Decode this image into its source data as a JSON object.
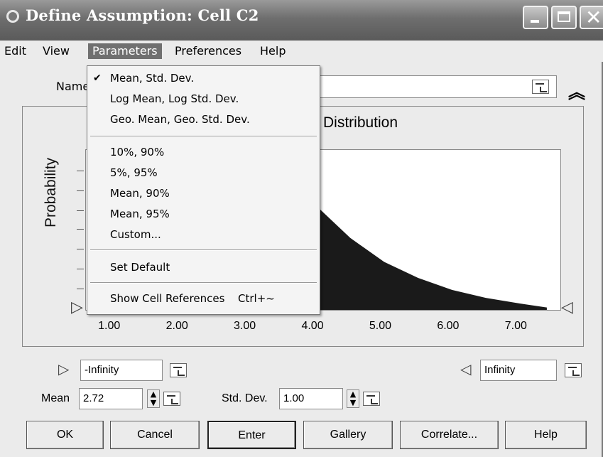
{
  "window": {
    "title": "Define Assumption: Cell C2",
    "controls": {
      "minimize": "minimize-icon",
      "maximize": "maximize-icon",
      "close": "close-icon"
    }
  },
  "menubar": [
    "Edit",
    "View",
    "Parameters",
    "Preferences",
    "Help"
  ],
  "parameters_menu": {
    "groups": [
      [
        "Mean, Std. Dev.",
        "Log Mean, Log Std. Dev.",
        "Geo. Mean, Geo. Std. Dev."
      ],
      [
        "10%, 90%",
        "5%, 95%",
        "Mean, 90%",
        "Mean, 95%",
        "Custom..."
      ],
      [
        "Set Default"
      ],
      [
        "Show Cell References"
      ]
    ],
    "checked": "Mean, Std. Dev.",
    "shortcut": "Ctrl+~"
  },
  "name_label": "Name",
  "chart": {
    "title": "Distribution",
    "ylabel": "Probability"
  },
  "chart_data": {
    "type": "area",
    "title": "Distribution",
    "xlabel": "",
    "ylabel": "Probability",
    "x_ticks": [
      "1.00",
      "2.00",
      "3.00",
      "4.00",
      "5.00",
      "6.00",
      "7.00"
    ],
    "xlim": [
      0.6,
      7.6
    ],
    "x": [
      3.6,
      4.0,
      4.5,
      5.0,
      5.5,
      6.0,
      6.5,
      7.0,
      7.4
    ],
    "y": [
      0.17,
      0.13,
      0.09,
      0.06,
      0.04,
      0.025,
      0.015,
      0.008,
      0.003
    ],
    "fill_color": "#1a1a1a"
  },
  "bounds": {
    "lower": "-Infinity",
    "upper": "Infinity"
  },
  "params": {
    "mean_label": "Mean",
    "mean_value": "2.72",
    "std_label": "Std. Dev.",
    "std_value": "1.00"
  },
  "buttons": [
    "OK",
    "Cancel",
    "Enter",
    "Gallery",
    "Correlate...",
    "Help"
  ],
  "colors": {
    "menu_highlight": "#707070",
    "titlebar": "#6e6e6e"
  }
}
